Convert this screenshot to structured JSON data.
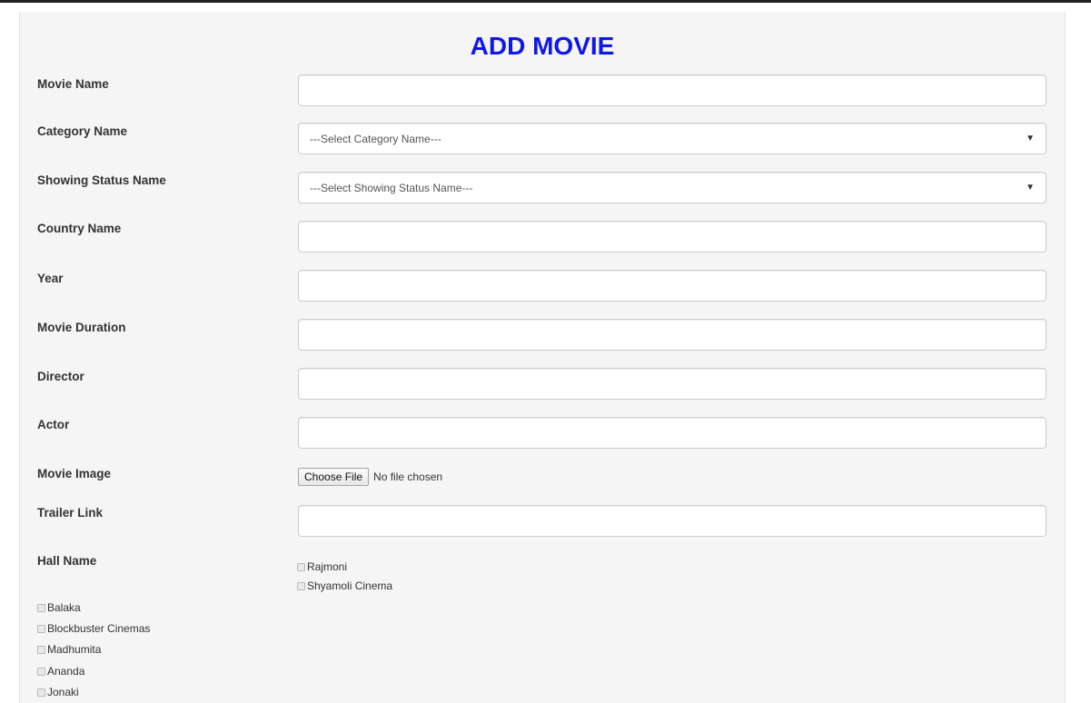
{
  "form": {
    "title": "ADD MOVIE",
    "movie_name": {
      "label": "Movie Name",
      "value": ""
    },
    "category": {
      "label": "Category Name",
      "selected": "---Select Category Name---"
    },
    "showing_status": {
      "label": "Showing Status Name",
      "selected": "---Select Showing Status Name---"
    },
    "country": {
      "label": "Country Name",
      "value": ""
    },
    "year": {
      "label": "Year",
      "value": ""
    },
    "duration": {
      "label": "Movie Duration",
      "value": ""
    },
    "director": {
      "label": "Director",
      "value": ""
    },
    "actor": {
      "label": "Actor",
      "value": ""
    },
    "movie_image": {
      "label": "Movie Image",
      "button": "Choose File",
      "status": "No file chosen"
    },
    "trailer": {
      "label": "Trailer Link",
      "value": ""
    },
    "halls": {
      "label": "Hall Name",
      "items": [
        "Rajmoni",
        "Shyamoli Cinema",
        "Balaka",
        "Blockbuster Cinemas",
        "Madhumita",
        "Ananda",
        "Jonaki"
      ]
    }
  },
  "icons": {
    "select_arrow": "caret-down-icon",
    "checkbox": "checkbox-icon"
  },
  "colors": {
    "title": "#0f18e6",
    "panel_bg": "#f5f5f5",
    "input_border": "#cccccc"
  }
}
